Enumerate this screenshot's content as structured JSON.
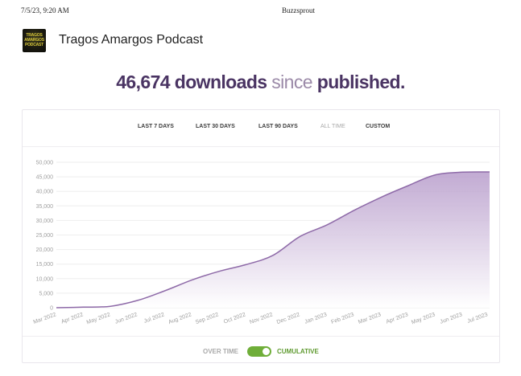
{
  "print_header": {
    "date": "7/5/23, 9:20 AM",
    "site": "Buzzsprout"
  },
  "podcast": {
    "title": "Tragos Amargos Podcast",
    "cover_text": "TRAGOS AMARGOS PODCAST"
  },
  "headline": {
    "count": "46,674",
    "downloads": "downloads",
    "since": "since",
    "published": "published."
  },
  "tabs": [
    {
      "label": "LAST 7 DAYS",
      "active": false
    },
    {
      "label": "LAST 30 DAYS",
      "active": false
    },
    {
      "label": "LAST 90 DAYS",
      "active": false
    },
    {
      "label": "ALL TIME",
      "active": true
    },
    {
      "label": "CUSTOM",
      "active": false
    }
  ],
  "toggle": {
    "left_label": "OVER TIME",
    "right_label": "CUMULATIVE",
    "state": "cumulative"
  },
  "colors": {
    "accent": "#4a3463",
    "series": "#8e6aa8",
    "fill": "#c8b3d6",
    "toggle_on": "#6fae39"
  },
  "chart_data": {
    "type": "area",
    "title": "",
    "xlabel": "",
    "ylabel": "",
    "ylim": [
      0,
      50000
    ],
    "yticks": [
      "0",
      "5,000",
      "10,000",
      "15,000",
      "20,000",
      "25,000",
      "30,000",
      "35,000",
      "40,000",
      "45,000",
      "50,000"
    ],
    "x": [
      "Mar 2022",
      "Apr 2022",
      "May 2022",
      "Jun 2022",
      "Jul 2022",
      "Aug 2022",
      "Sep 2022",
      "Oct 2022",
      "Nov 2022",
      "Dec 2022",
      "Jan 2023",
      "Feb 2023",
      "Mar 2023",
      "Apr 2023",
      "May 2023",
      "Jun 2023",
      "Jul 2023"
    ],
    "series": [
      {
        "values": [
          0,
          200,
          500,
          2500,
          5800,
          9500,
          12500,
          14800,
          18000,
          24500,
          28500,
          33500,
          38000,
          42000,
          45700,
          46600,
          46674
        ]
      }
    ],
    "grid": true
  }
}
